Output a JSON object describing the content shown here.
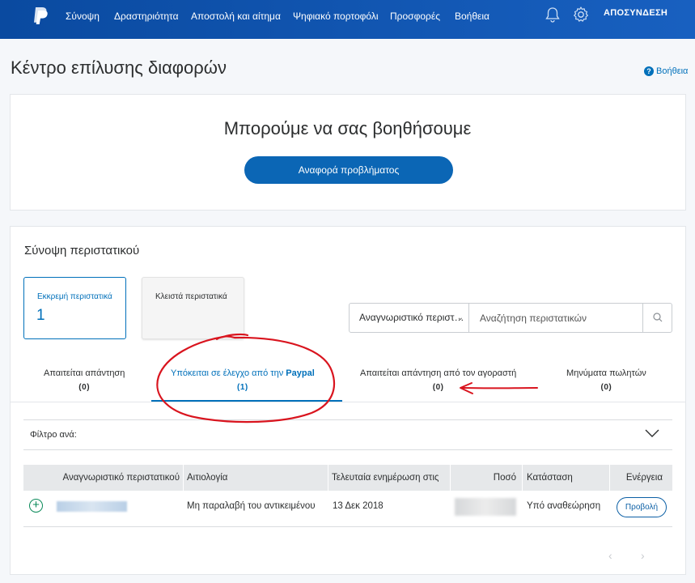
{
  "nav": {
    "items": [
      "Σύνοψη",
      "Δραστηριότητα",
      "Αποστολή και αίτημα",
      "Ψηφιακό πορτοφόλι",
      "Προσφορές",
      "Βοήθεια"
    ],
    "logout": "ΑΠΟΣΥΝΔΕΣΗ",
    "icons": [
      "bell-icon",
      "gear-icon"
    ]
  },
  "page": {
    "title": "Κέντρο επίλυσης διαφορών",
    "help": "Βοήθεια"
  },
  "help_card": {
    "heading": "Μπορούμε να σας βοηθήσουμε",
    "button": "Αναφορά προβλήματος"
  },
  "summary": {
    "title": "Σύνοψη περιστατικού",
    "open_label": "Εκκρεμή περιστατικά",
    "open_count": "1",
    "closed_label": "Κλειστά περιστατικά",
    "search_select": "Αναγνωριστικό περιστ…",
    "search_placeholder": "Αναζήτηση περιστατικών",
    "tabs": [
      {
        "label": "Απαιτείται απάντηση",
        "count": "(0)"
      },
      {
        "label_prefix": "Υπόκειται σε έλεγχο από την ",
        "label_bold": "Paypal",
        "count": "(1)"
      },
      {
        "label": "Απαιτείται απάντηση από τον αγοραστή",
        "count": "(0)"
      },
      {
        "label": "Μηνύματα πωλητών",
        "count": "(0)"
      }
    ],
    "filter_label": "Φίλτρο ανά:"
  },
  "table": {
    "headers": [
      "Αναγνωριστικό περιστατικού",
      "Αιτιολογία",
      "Τελευταία ενημέρωση στις",
      "Ποσό",
      "Κατάσταση",
      "Ενέργεια"
    ],
    "rows": [
      {
        "reason": "Μη παραλαβή του αντικειμένου",
        "updated": "13 Δεκ 2018",
        "status": "Υπό αναθεώρηση",
        "action": "Προβολή"
      }
    ]
  },
  "pager": {
    "prev": "‹",
    "next": "›"
  },
  "colors": {
    "brand": "#0b4fa8",
    "accent": "#0070ba",
    "annotation": "#d9141e"
  }
}
